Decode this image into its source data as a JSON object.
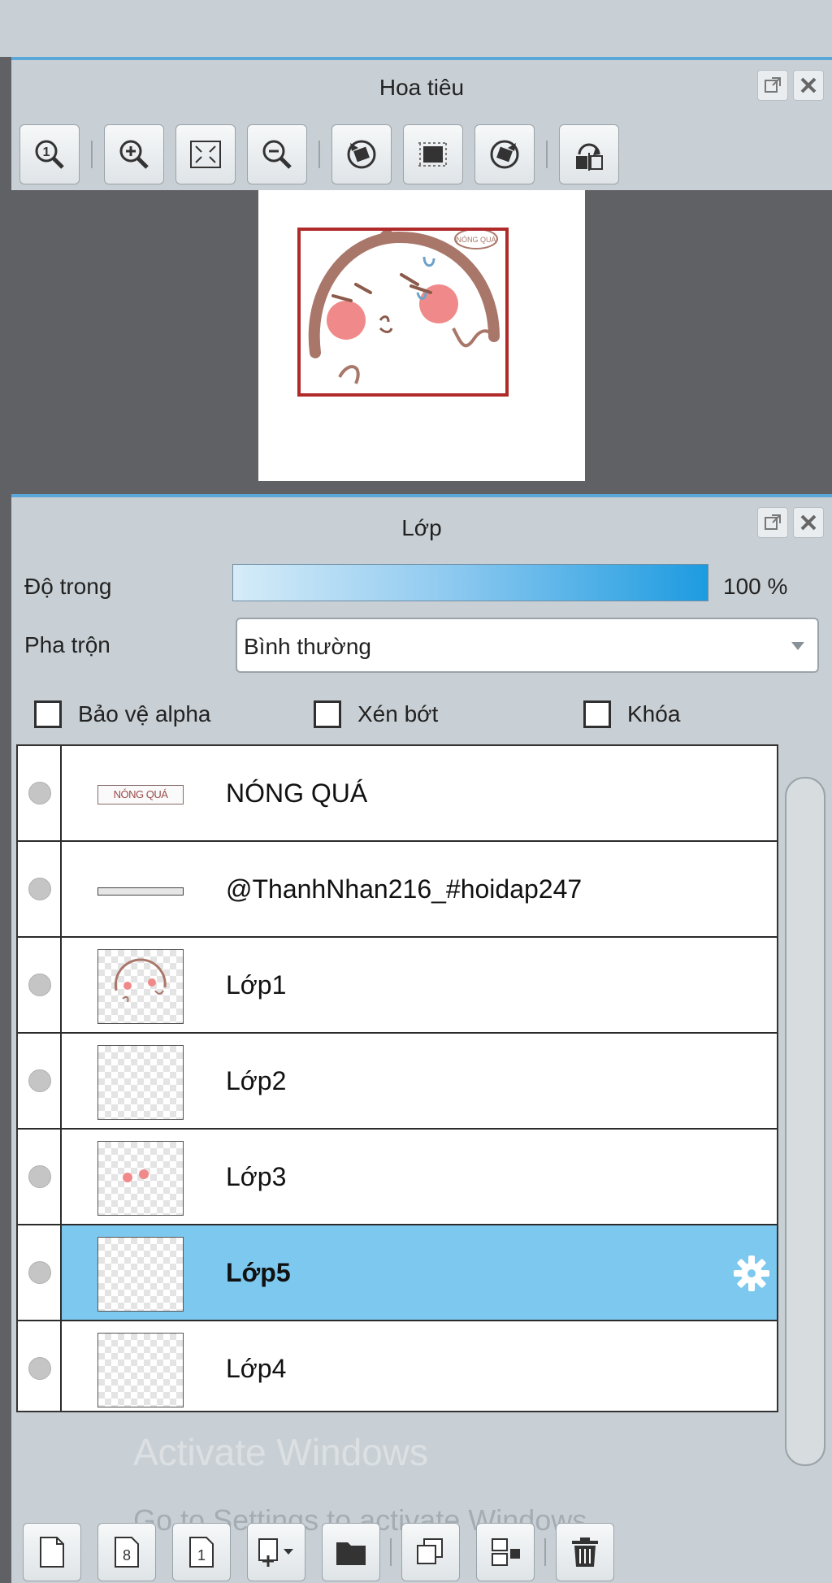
{
  "navigator": {
    "title": "Hoa tiêu",
    "toolbar": [
      {
        "icon": "zoom-actual-size-icon"
      },
      {
        "icon": "zoom-in-icon"
      },
      {
        "icon": "fit-to-window-icon"
      },
      {
        "icon": "zoom-out-icon"
      },
      {
        "icon": "rotate-left-icon"
      },
      {
        "icon": "reset-view-icon"
      },
      {
        "icon": "rotate-right-icon"
      },
      {
        "icon": "flip-horizontal-icon"
      }
    ],
    "preview_text": "NÓNG QUÁ"
  },
  "layers": {
    "title": "Lớp",
    "opacity_label": "Độ trong",
    "opacity_value": "100 %",
    "opacity_level": 1.0,
    "blend_label": "Pha trộn",
    "blend_value": "Bình thường",
    "checkboxes": {
      "protect_alpha": {
        "label": "Bảo vệ alpha",
        "checked": false
      },
      "clipping": {
        "label": "Xén bớt",
        "checked": false
      },
      "lock": {
        "label": "Khóa",
        "checked": false
      }
    },
    "items": [
      {
        "name": "NÓNG QUÁ",
        "thumb": "text",
        "thumb_text": "NÓNG QUÁ",
        "selected": false
      },
      {
        "name": "@ThanhNhan216_#hoidap247",
        "thumb": "line",
        "selected": false
      },
      {
        "name": "Lớp1",
        "thumb": "sketch",
        "selected": false
      },
      {
        "name": "Lớp2",
        "thumb": "empty",
        "selected": false
      },
      {
        "name": "Lớp3",
        "thumb": "dots",
        "selected": false
      },
      {
        "name": "Lớp5",
        "thumb": "faint",
        "selected": true
      },
      {
        "name": "Lớp4",
        "thumb": "faint",
        "selected": false
      }
    ]
  },
  "bottom_toolbar": [
    {
      "icon": "new-color-layer-icon"
    },
    {
      "icon": "new-8bit-layer-icon"
    },
    {
      "icon": "new-1bit-layer-icon"
    },
    {
      "icon": "add-layer-dropdown-icon"
    },
    {
      "icon": "new-folder-icon"
    },
    {
      "icon": "duplicate-layer-icon"
    },
    {
      "icon": "merge-down-icon"
    },
    {
      "icon": "delete-layer-icon"
    }
  ],
  "watermark": {
    "line1": "Activate Windows",
    "line2": "Go to Settings to activate Windows."
  },
  "colors": {
    "accent": "#5aa7d9",
    "selected_row": "#7cc8ef",
    "panel_bg": "#c9d0d5",
    "dark_area": "#5f6164"
  }
}
